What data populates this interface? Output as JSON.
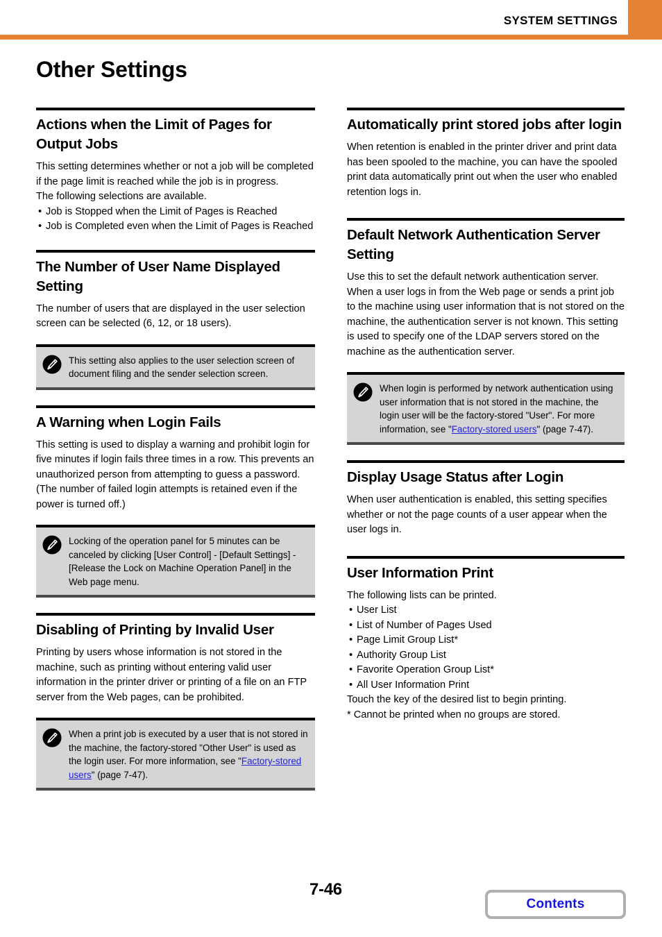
{
  "header": {
    "title": "SYSTEM SETTINGS",
    "accent_color": "#e58234"
  },
  "page_title": "Other Settings",
  "left_column": {
    "sections": [
      {
        "heading": "Actions when the Limit of Pages for Output Jobs",
        "paragraphs": [
          "This setting determines whether or not a job will be completed if the page limit is reached while the job is in progress.",
          "The following selections are available."
        ],
        "bullets": [
          "Job is Stopped when the Limit of Pages is Reached",
          "Job is Completed even when the Limit of Pages is Reached"
        ]
      },
      {
        "heading": "The Number of User Name Displayed Setting",
        "paragraphs": [
          "The number of users that are displayed in the user selection screen can be selected (6, 12, or 18 users)."
        ],
        "note": {
          "icon": "note-pencil-icon",
          "text": "This setting also applies to the user selection screen of document filing and the sender selection screen."
        }
      },
      {
        "heading": "A Warning when Login Fails",
        "paragraphs": [
          "This setting is used to display a warning and prohibit login for five minutes if login fails three times in a row. This prevents an unauthorized person from attempting to guess a password. (The number of failed login attempts is retained even if the power is turned off.)"
        ],
        "note": {
          "icon": "note-pencil-icon",
          "text": "Locking of the operation panel for 5 minutes can be canceled by clicking [User Control] - [Default Settings] - [Release the Lock on Machine Operation Panel] in the Web page menu."
        }
      },
      {
        "heading": "Disabling of Printing by Invalid User",
        "paragraphs": [
          "Printing by users whose information is not stored in the machine, such as printing without entering valid user information in the printer driver or printing of a file on an FTP server from the Web pages, can be prohibited."
        ],
        "note": {
          "icon": "note-pencil-icon",
          "text_before_link": "When a print job is executed by a user that is not stored in the machine, the factory-stored \"Other User\" is used as the login user. For more information, see \"",
          "link_text": "Factory-stored users",
          "text_after_link": "\" (page 7-47)."
        }
      }
    ]
  },
  "right_column": {
    "sections": [
      {
        "heading": "Automatically print stored jobs after login",
        "paragraphs": [
          "When retention is enabled in the printer driver and print data has been spooled to the machine, you can have the spooled print data automatically print out when the user who enabled retention logs in."
        ]
      },
      {
        "heading": "Default Network Authentication Server Setting",
        "paragraphs": [
          "Use this to set the default network authentication server. When a user logs in from the Web page or sends a print job to the machine using user information that is not stored on the machine, the authentication server is not known. This setting is used to specify one of the LDAP servers stored on the machine as the authentication server."
        ],
        "note": {
          "icon": "note-pencil-icon",
          "text_before_link": "When login is performed by network authentication using user information that is not stored in the machine, the login user will be the factory-stored \"User\". For more information, see \"",
          "link_text": "Factory-stored users",
          "text_after_link": "\" (page 7-47)."
        }
      },
      {
        "heading": "Display Usage Status after Login",
        "paragraphs": [
          "When user authentication is enabled, this setting specifies whether or not the page counts of a user appear when the user logs in."
        ]
      },
      {
        "heading": "User Information Print",
        "paragraphs": [
          "The following lists can be printed."
        ],
        "bullets": [
          "User List",
          "List of Number of Pages Used",
          "Page Limit Group List*",
          "Authority Group List",
          "Favorite Operation Group List*",
          "All User Information Print"
        ],
        "after_bullets": [
          "Touch the key of the desired list to begin printing.",
          "*  Cannot be printed when no groups are stored."
        ]
      }
    ]
  },
  "footer": {
    "page_number": "7-46",
    "contents_label": "Contents",
    "contents_color": "#1414e0"
  }
}
